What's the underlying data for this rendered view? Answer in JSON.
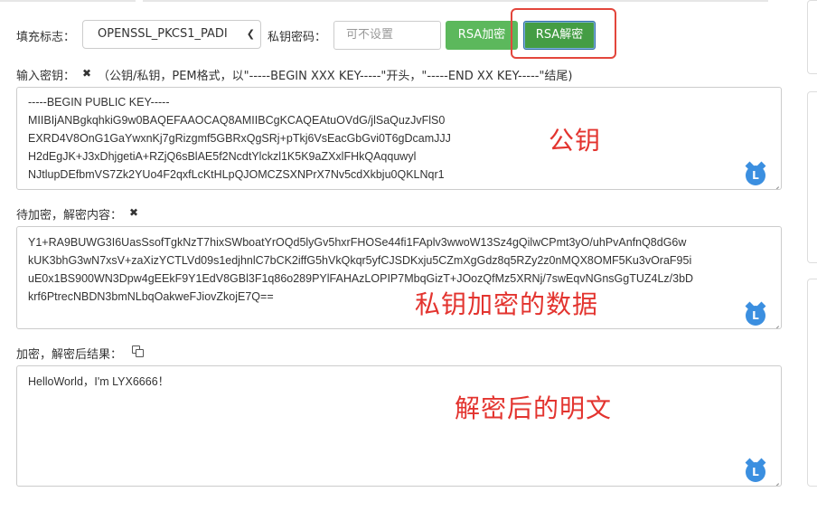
{
  "toolbar": {
    "padding_label": "填充标志：",
    "padding_value": "OPENSSL_PKCS1_PADI",
    "password_label": "私钥密码：",
    "password_placeholder": "可不设置",
    "encrypt_button": "RSA加密",
    "decrypt_button": "RSA解密"
  },
  "key_section": {
    "label": "输入密钥：",
    "clear_icon": "✖",
    "hint": "（公钥/私钥，PEM格式，以\"-----BEGIN XXX KEY-----\"开头，\"-----END XX KEY-----\"结尾)",
    "lines": [
      "-----BEGIN PUBLIC KEY-----",
      "MIIBIjANBgkqhkiG9w0BAQEFAAOCAQ8AMIIBCgKCAQEAtuOVdG/jlSaQuzJvFlS0",
      "EXRD4V8OnG1GaYwxnKj7gRizgmf5GBRxQgSRj+pTkj6VsEacGbGvi0T6gDcamJJJ",
      "H2dEgJK+J3xDhjgetiA+RZjQ6sBlAE5f2NcdtYlckzl1K5K9aZXxlFHkQAqquwyl",
      "NJtlupDEfbmVS7Zk2YUo4F2qxfLcKtHLpQJOMCZSXNPrX7Nv5cdXkbju0QKLNqr1"
    ],
    "annotation": "公钥"
  },
  "data_section": {
    "label": "待加密，解密内容：",
    "clear_icon": "✖",
    "lines": [
      "Y1+RA9BUWG3I6UasSsofTgkNzT7hixSWboatYrOQd5lyGv5hxrFHOSe44fi1FAplv3wwoW13Sz4gQilwCPmt3yO/uhPvAnfnQ8dG6w",
      "kUK3bhG3wN7xsV+zaXizYCTLVd09s1edjhnlC7bCK2iffG5hVkQkqr5yfCJSDKxju5CZmXgGdz8q5RZy2z0nMQX8OMF5Ku3vOraF95i",
      "uE0x1BS900WN3Dpw4gEEkF9Y1EdV8GBl3F1q86o289PYlFAHAzLOPIP7MbqGizT+JOozQfMz5XRNj/7swEqvNGnsGgTUZ4Lz/3bD",
      "krf6PtrecNBDN3bmNLbqOakweFJiovZkojE7Q=="
    ],
    "annotation": "私钥加密的数据"
  },
  "result_section": {
    "label": "加密，解密后结果：",
    "value": "HelloWorld，I'm LYX6666！",
    "annotation": "解密后的明文"
  },
  "colors": {
    "green": "#5cb85c",
    "dark_green": "#449d44",
    "annotation_red": "#e3342f",
    "badge_blue": "#3b8fe0"
  }
}
